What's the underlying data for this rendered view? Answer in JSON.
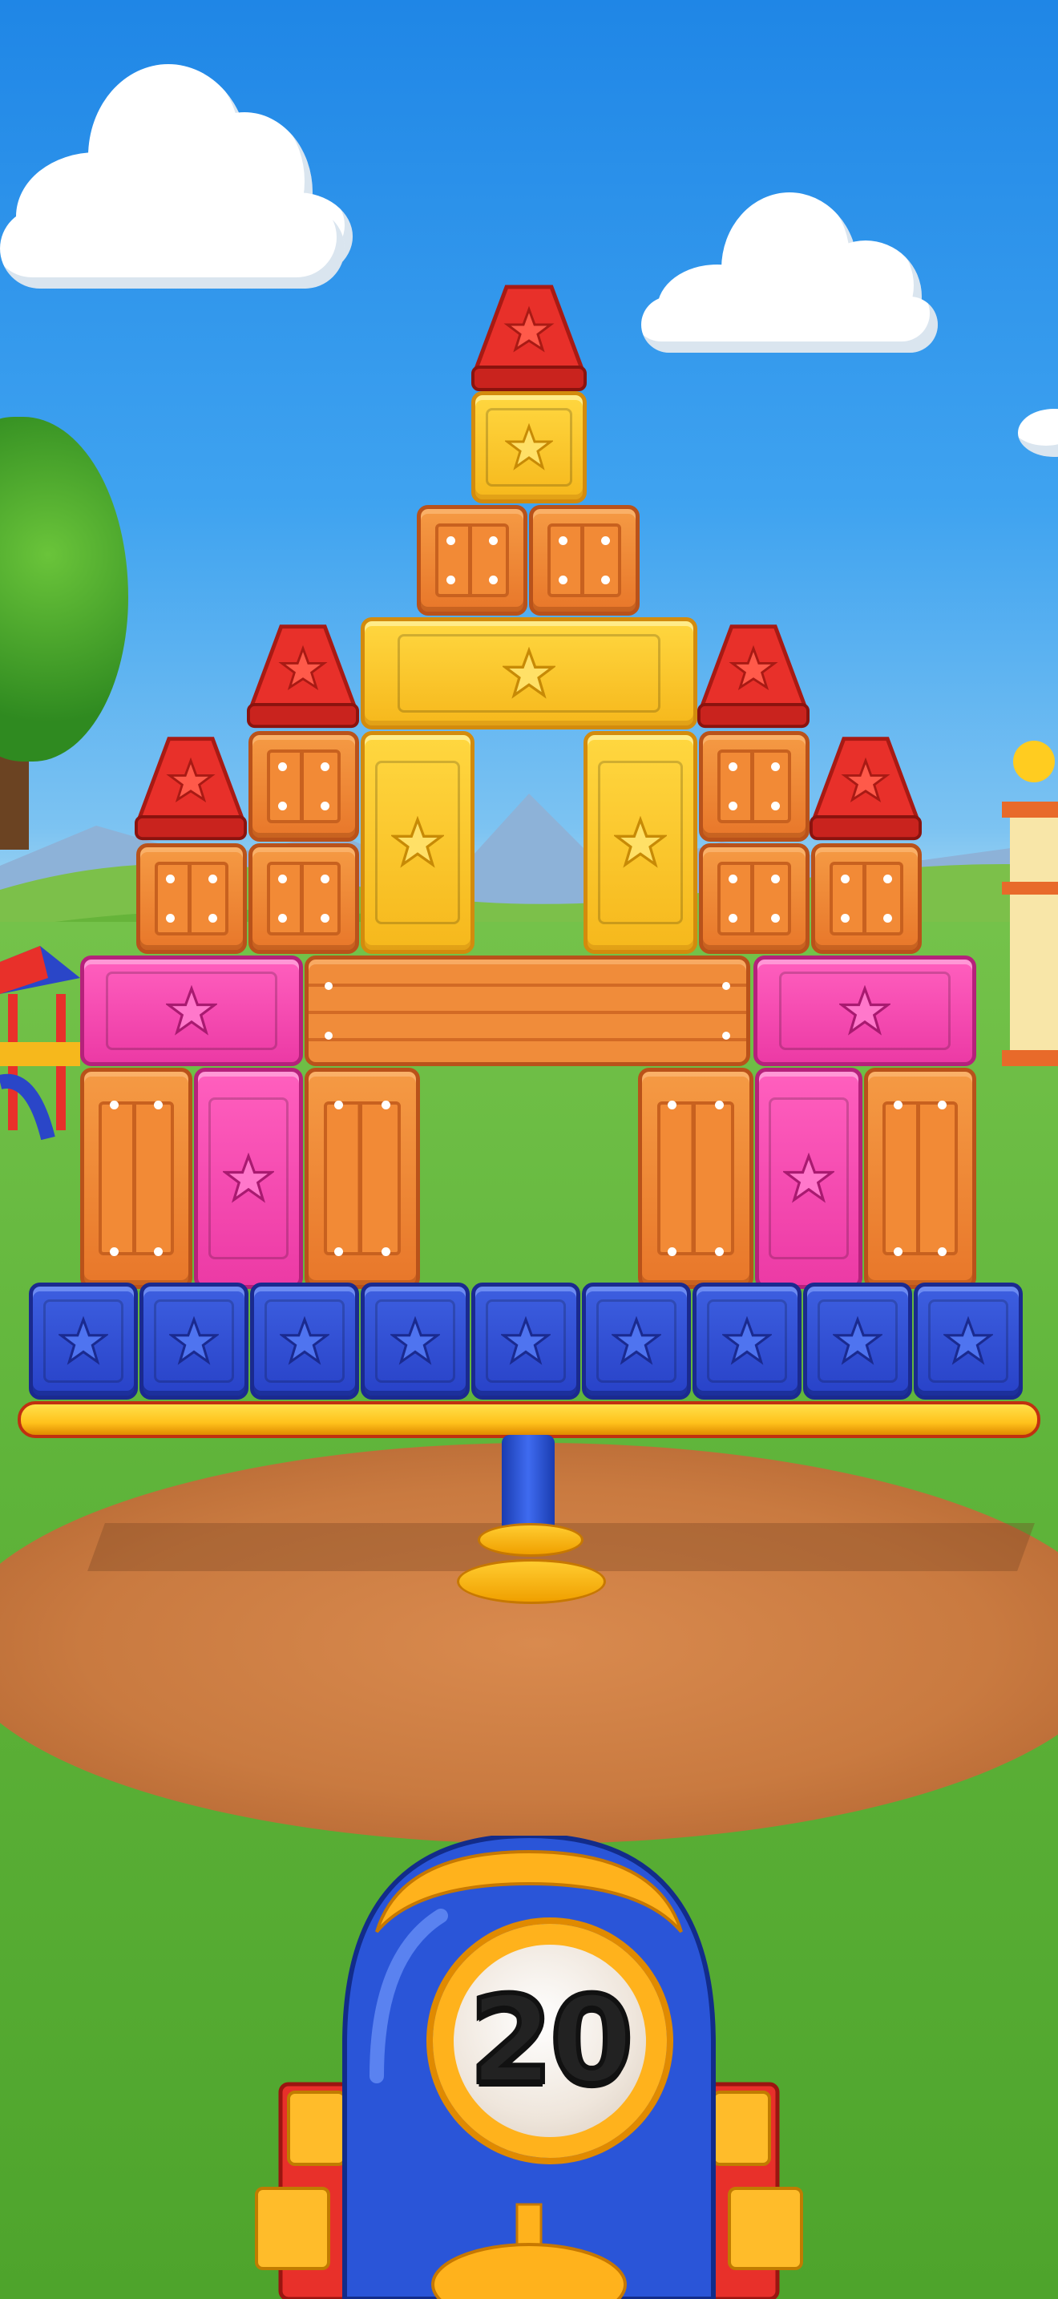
{
  "game": {
    "shots_remaining": "20"
  },
  "colors": {
    "sky": "#3fa3f0",
    "crate": "#f28a36",
    "yellow_block": "#ffd740",
    "pink_block": "#ff5fbe",
    "blue_block": "#2842c8",
    "roof": "#e8302a",
    "cannon_body": "#2a55d8",
    "cannon_ring": "#ffb21c"
  },
  "icons": [
    "star-icon",
    "cannon-icon",
    "cloud-icon",
    "tree-icon"
  ]
}
